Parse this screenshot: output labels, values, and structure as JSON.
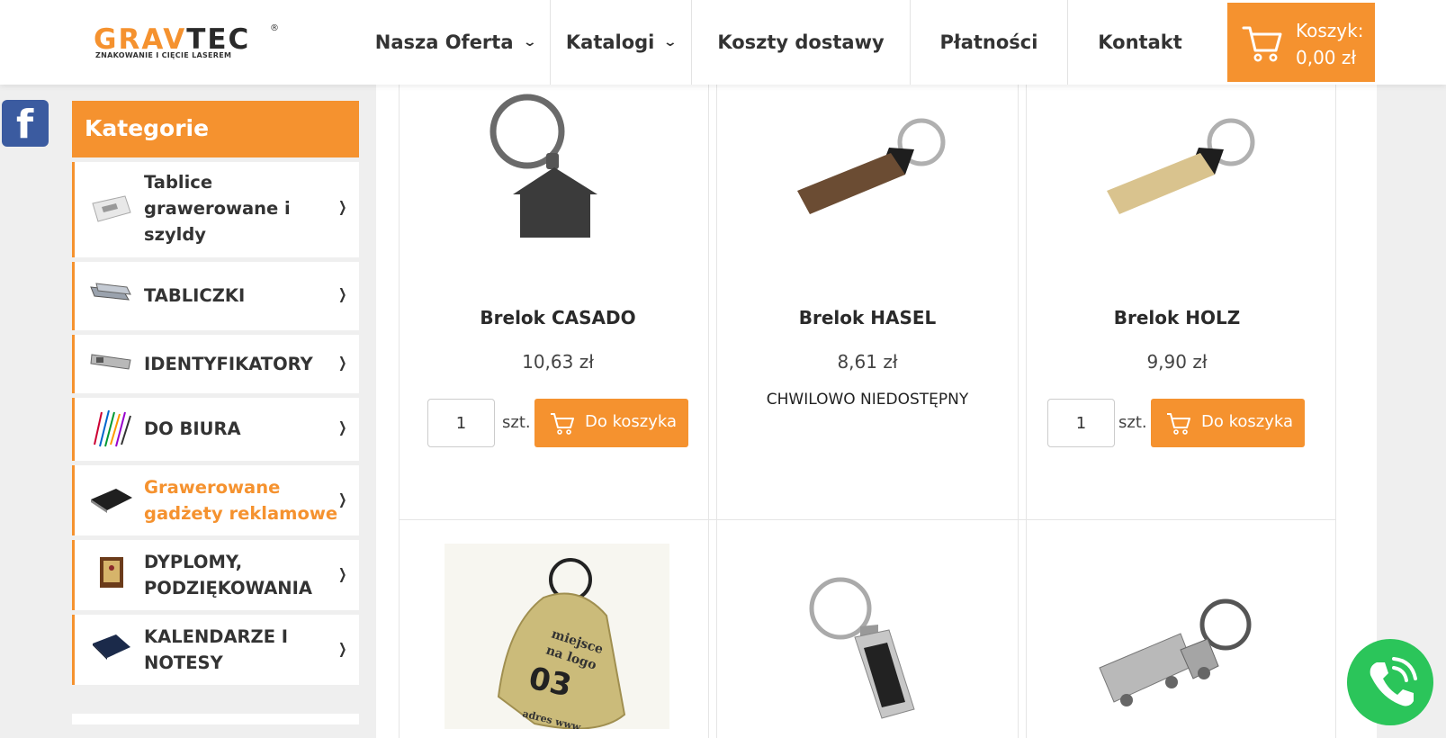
{
  "header": {
    "logo": {
      "main_orange": "GRAV",
      "main_dark": "TEC",
      "registered": "®",
      "tagline": "ZNAKOWANIE I CIĘCIE LASEREM"
    },
    "nav": [
      {
        "label": "Nasza Oferta",
        "has_dropdown": true
      },
      {
        "label": "Katalogi",
        "has_dropdown": true
      },
      {
        "label": "Koszty dostawy",
        "has_dropdown": false
      },
      {
        "label": "Płatności",
        "has_dropdown": false
      },
      {
        "label": "Kontakt",
        "has_dropdown": false
      }
    ],
    "cart": {
      "label": "Koszyk:",
      "amount": "0,00 zł",
      "icon": "cart-icon"
    }
  },
  "social": {
    "facebook_glyph": "f"
  },
  "sidebar": {
    "title": "Kategorie",
    "items": [
      {
        "label_lines": [
          "Tablice",
          "grawerowane i",
          "szyldy"
        ],
        "active": false,
        "thumb": "plaque-thumb"
      },
      {
        "label_lines": [
          "TABLICZKI"
        ],
        "active": false,
        "thumb": "small-plates-thumb"
      },
      {
        "label_lines": [
          "IDENTYFIKATORY"
        ],
        "active": false,
        "thumb": "badge-thumb"
      },
      {
        "label_lines": [
          "DO BIURA"
        ],
        "active": false,
        "thumb": "pens-thumb"
      },
      {
        "label_lines": [
          "Grawerowane",
          "gadżety reklamowe"
        ],
        "active": true,
        "thumb": "card-holder-thumb"
      },
      {
        "label_lines": [
          "DYPLOMY,",
          "PODZIĘKOWANIA"
        ],
        "active": false,
        "thumb": "diploma-thumb"
      },
      {
        "label_lines": [
          "KALENDARZE I",
          "NOTESY"
        ],
        "active": false,
        "thumb": "notebook-thumb"
      }
    ]
  },
  "products": [
    {
      "name": "Brelok CASADO",
      "price": "10,63 zł",
      "available": true,
      "qty": "1",
      "unit": "szt.",
      "button": "Do koszyka",
      "image": "house-keyring"
    },
    {
      "name": "Brelok HASEL",
      "price": "8,61 zł",
      "available": false,
      "status": "CHWILOWO NIEDOSTĘPNY",
      "image": "walnut-keyring"
    },
    {
      "name": "Brelok HOLZ",
      "price": "9,90 zł",
      "available": true,
      "qty": "1",
      "unit": "szt.",
      "button": "Do koszyka",
      "image": "bamboo-keyring"
    },
    {
      "name": "",
      "image": "brass-tag-keyring",
      "tag_text": [
        "miejsce",
        "na logo",
        "03",
        "adres www"
      ]
    },
    {
      "name": "",
      "image": "metal-rectangle-keyring"
    },
    {
      "name": "",
      "image": "truck-keyring"
    }
  ],
  "colors": {
    "accent": "#f5922f",
    "facebook": "#3b5ba0",
    "phone": "#2bc55a",
    "background": "#efefef"
  }
}
